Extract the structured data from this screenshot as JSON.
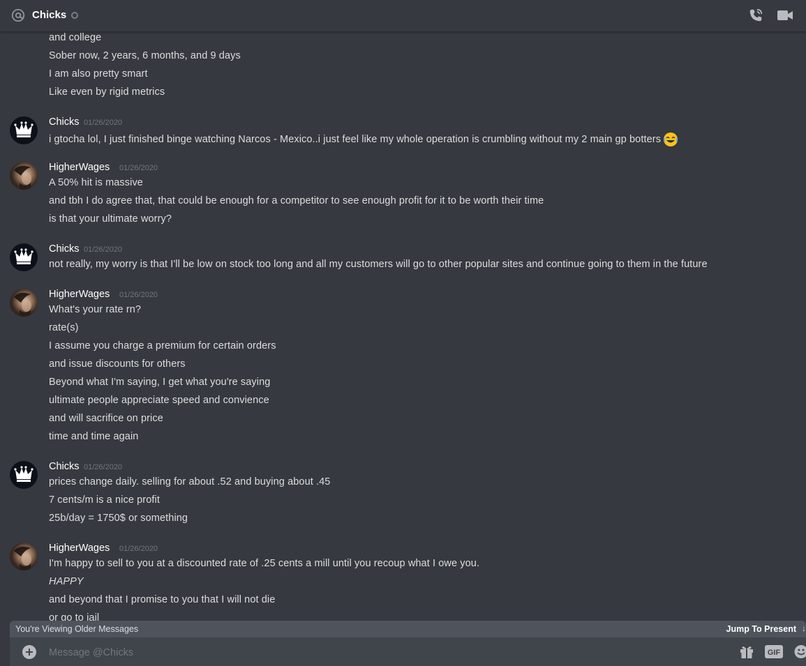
{
  "header": {
    "title": "Chicks",
    "icons": {
      "mention": "at-icon",
      "status": "status-offline-icon",
      "call": "voice-call-icon",
      "video": "video-call-icon"
    }
  },
  "messages": {
    "fragment_lines": [
      "and college",
      "Sober now, 2 years, 6 months, and 9 days",
      "I am also pretty smart",
      "Like even by rigid metrics"
    ],
    "groups": [
      {
        "author": "Chicks",
        "timestamp": "01/26/2020",
        "avatar": "crown-avatar",
        "lines": [
          "i gtocha lol, I just finished binge watching Narcos - Mexico..i just feel like my whole operation is crumbling without my 2 main gp botters"
        ],
        "emoji": "joy-emoji"
      },
      {
        "author": "HigherWages",
        "timestamp": "01/26/2020",
        "avatar": "photo-avatar",
        "lines": [
          "A 50% hit is massive",
          "and tbh I do agree that, that could be enough for a competitor to see enough profit for it to be worth their time",
          "is that your ultimate worry?"
        ]
      },
      {
        "author": "Chicks",
        "timestamp": "01/26/2020",
        "avatar": "crown-avatar",
        "lines": [
          "not really, my worry is that I'll be low on stock too long and all my customers will go to other popular sites and continue going to them in the future"
        ]
      },
      {
        "author": "HigherWages",
        "timestamp": "01/26/2020",
        "avatar": "photo-avatar",
        "lines": [
          "What's your rate rn?",
          "rate(s)",
          "I assume you charge a premium for certain orders",
          "and issue discounts for others",
          "Beyond what I'm saying, I get what you're saying",
          "ultimate people appreciate speed and convience",
          "and will sacrifice on price",
          "time and time again"
        ]
      },
      {
        "author": "Chicks",
        "timestamp": "01/26/2020",
        "avatar": "crown-avatar",
        "lines": [
          "prices change daily. selling for about .52 and buying about .45",
          "7 cents/m is a nice profit",
          "25b/day = 1750$ or something"
        ]
      },
      {
        "author": "HigherWages",
        "timestamp": "01/26/2020",
        "avatar": "photo-avatar",
        "lines": [
          "I'm happy to sell to you at a discounted rate of .25 cents a mill until you recoup what I owe you.",
          "HAPPY",
          "and beyond that I promise to you that I will not die",
          "or go to jail"
        ]
      }
    ]
  },
  "older_bar": {
    "text": "You're Viewing Older Messages",
    "jump_label": "Jump To Present"
  },
  "composer": {
    "placeholder": "Message @Chicks",
    "value": "",
    "gif_label": "GIF"
  },
  "colors": {
    "background": "#36393f",
    "input": "#40444b",
    "older_bar": "#4f545c",
    "timestamp": "#72767d"
  }
}
